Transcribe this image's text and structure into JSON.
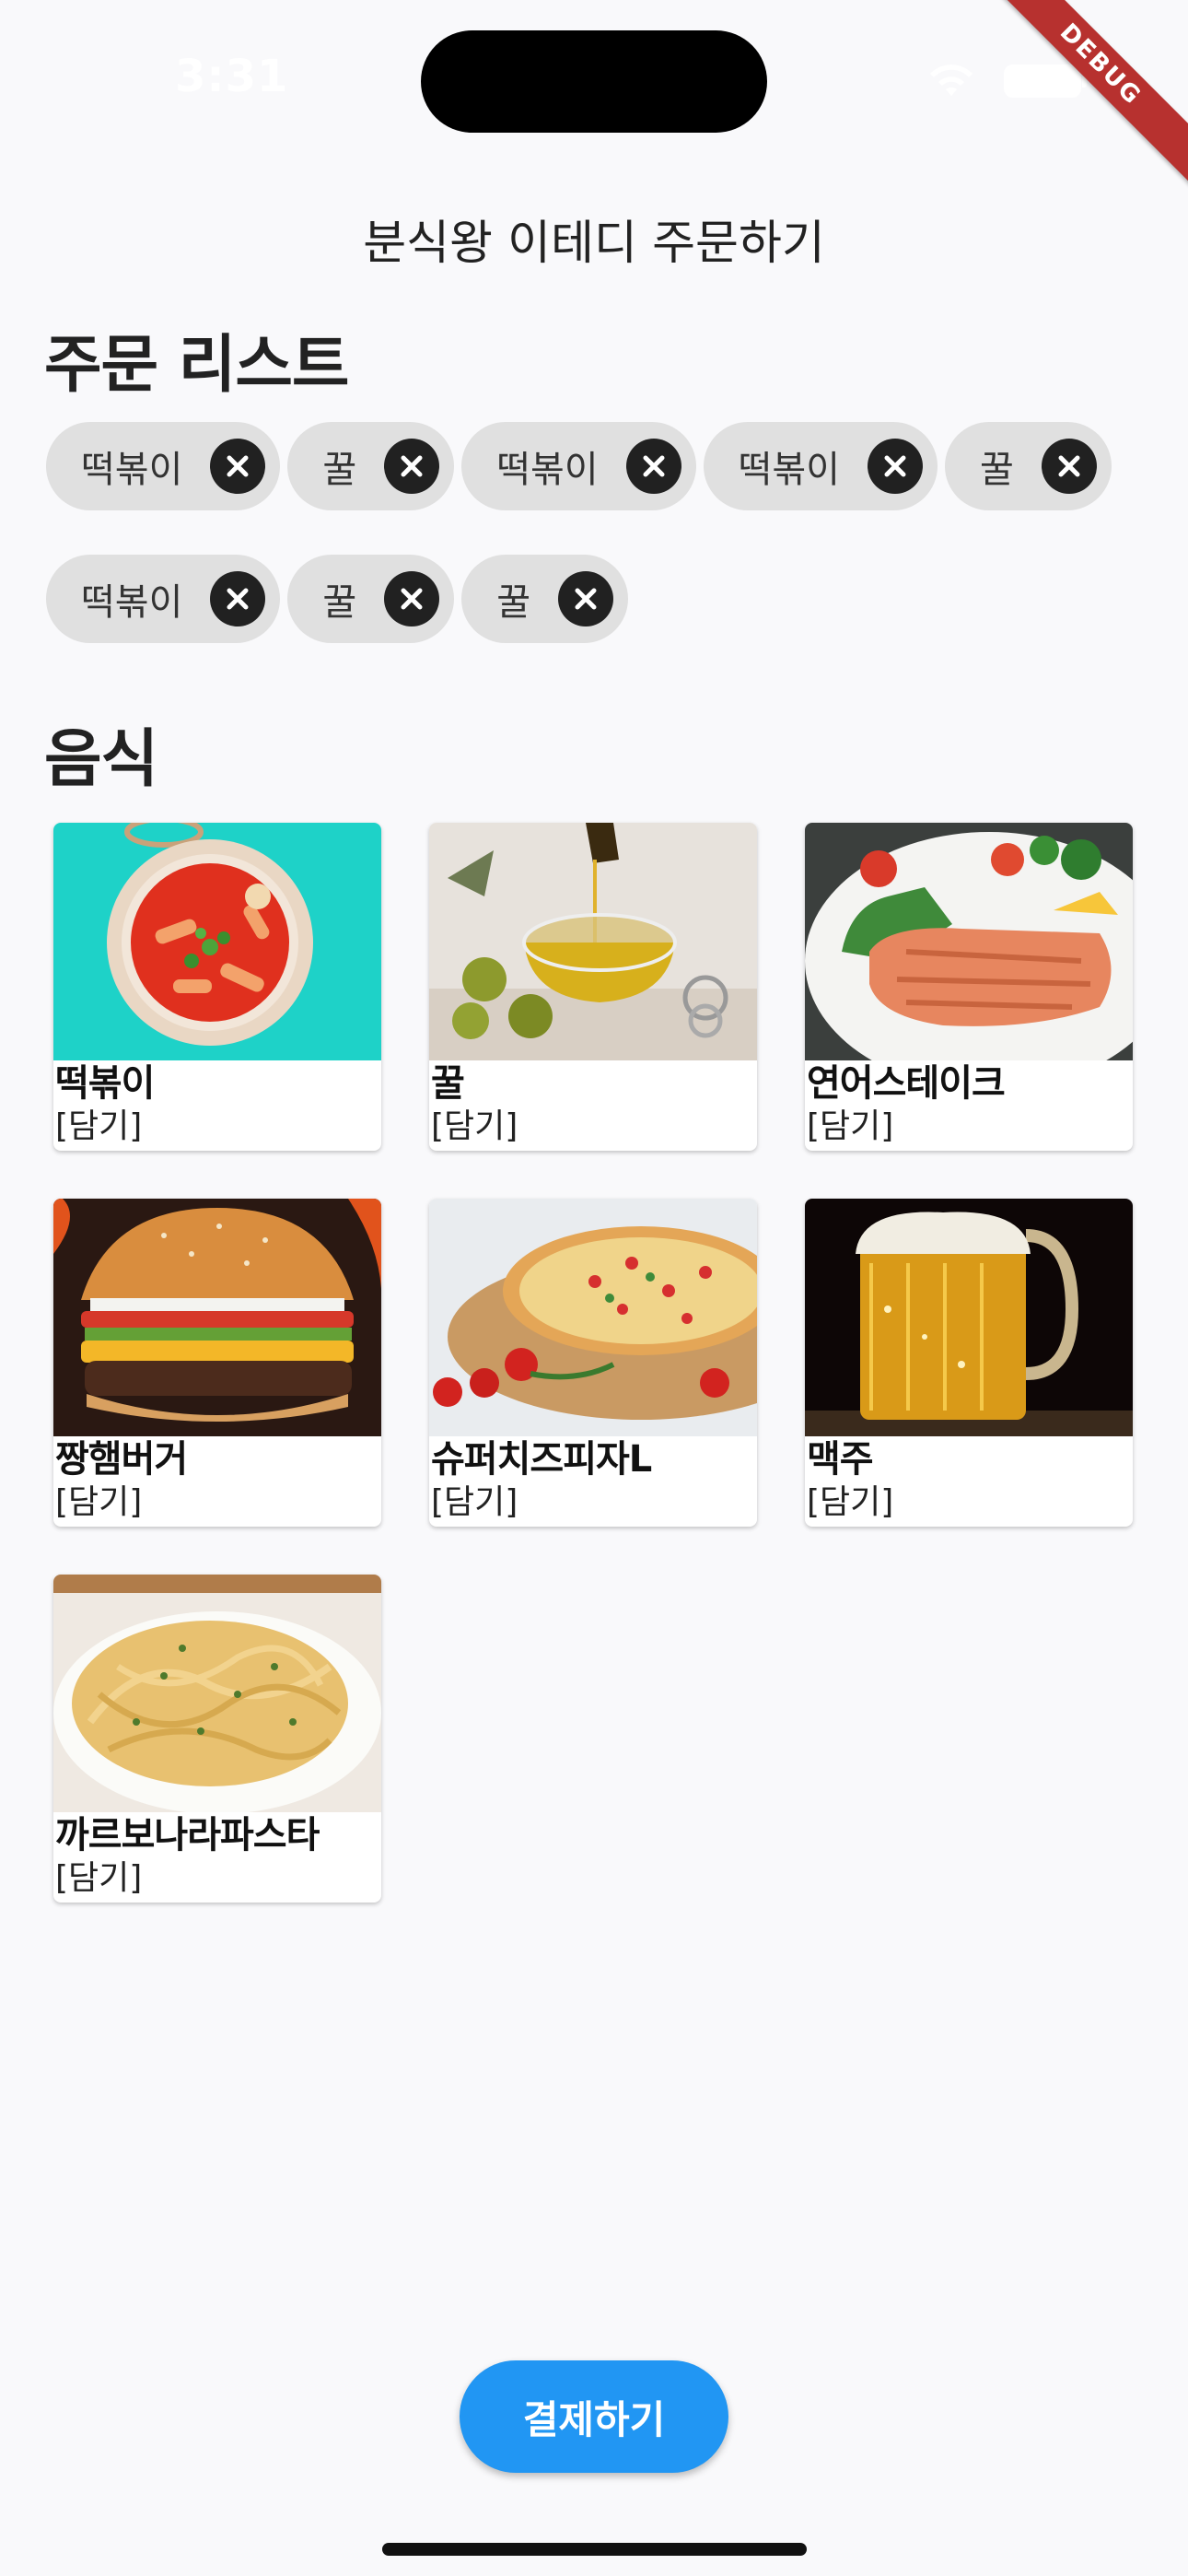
{
  "status_bar": {
    "time": "3:31"
  },
  "debug_banner": "DEBUG",
  "app_bar": {
    "title": "분식왕 이테디 주문하기"
  },
  "order_section": {
    "title": "주문 리스트",
    "items": [
      {
        "label": "떡볶이"
      },
      {
        "label": "꿀"
      },
      {
        "label": "떡볶이"
      },
      {
        "label": "떡볶이"
      },
      {
        "label": "꿀"
      },
      {
        "label": "떡볶이"
      },
      {
        "label": "꿀"
      },
      {
        "label": "꿀"
      }
    ]
  },
  "food_section": {
    "title": "음식",
    "add_label": "[담기]",
    "items": [
      {
        "name": "떡볶이"
      },
      {
        "name": "꿀"
      },
      {
        "name": "연어스테이크"
      },
      {
        "name": "짱햄버거"
      },
      {
        "name": "슈퍼치즈피자L"
      },
      {
        "name": "맥주"
      },
      {
        "name": "까르보나라파스타"
      }
    ]
  },
  "checkout": {
    "label": "결제하기"
  },
  "colors": {
    "accent": "#2196f3",
    "chip_bg": "#e0e0e0",
    "background": "#f9f9fb",
    "debug": "#b7312f"
  }
}
